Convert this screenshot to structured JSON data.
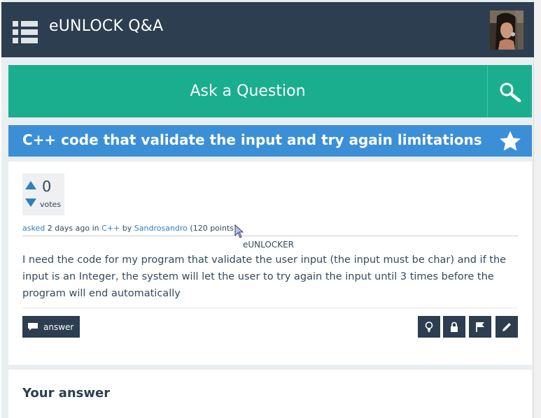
{
  "header": {
    "site_name": "eUNLOCK Q&A",
    "menu_icon": "list-menu-icon",
    "avatar_icon": "user-avatar"
  },
  "ask": {
    "label": "Ask a Question",
    "search_icon": "search-icon"
  },
  "question": {
    "title": "C++ code that validate the input and try again limitations",
    "favorite_icon": "star-icon",
    "votes": {
      "count": "0",
      "label": "votes"
    },
    "meta": {
      "asked_link": "asked",
      "time": "2 days ago",
      "in_word": "in",
      "category": "C++",
      "by_word": "by",
      "author": "Sandrosandro",
      "points": "(120 points)"
    },
    "tooltip": "eUNLOCKER",
    "body": "I need the code for my program that validate the user input (the input must be char) and if the input is an Integer, the system will let the user to try again the input until 3 times before the program will end automatically",
    "actions": {
      "answer_label": "answer",
      "tools": [
        "lightbulb-icon",
        "lock-icon",
        "flag-icon",
        "edit-icon"
      ]
    }
  },
  "answer_section": {
    "heading": "Your answer"
  },
  "colors": {
    "topbar": "#2c3e50",
    "ask": "#1aae8f",
    "title": "#3b8fd6",
    "link": "#2f7fbf"
  }
}
